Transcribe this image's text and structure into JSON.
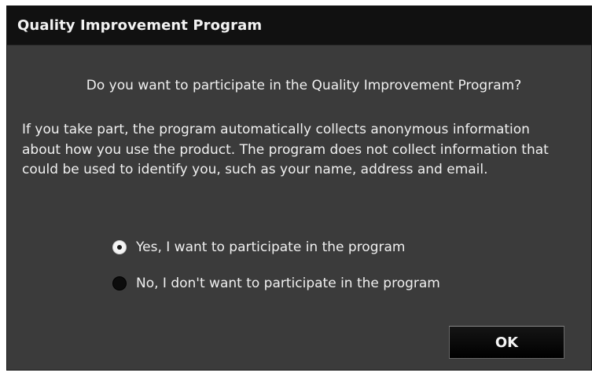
{
  "dialog": {
    "title": "Quality Improvement Program",
    "question": "Do you want to participate in the Quality Improvement Program?",
    "description": "If you take part, the program automatically collects anonymous information about how you use the product. The program does not collect information that could be used to identify you, such as your name, address and email.",
    "options": [
      {
        "label": "Yes, I want to participate in the program",
        "selected": true
      },
      {
        "label": "No, I don't want to participate in the program",
        "selected": false
      }
    ],
    "ok_label": "OK"
  }
}
